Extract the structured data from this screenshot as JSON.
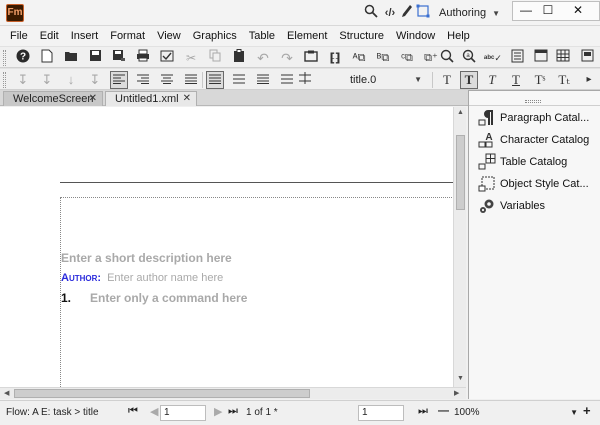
{
  "app": {
    "logo": "Fm",
    "workspace": "Authoring"
  },
  "title_icons": [
    "search-icon",
    "code-view-icon",
    "pen-icon",
    "frame-select-icon"
  ],
  "window_controls": {
    "minimize": "—",
    "maximize": "☐",
    "close": "✕"
  },
  "menu": [
    "File",
    "Edit",
    "Insert",
    "Format",
    "View",
    "Graphics",
    "Table",
    "Element",
    "Structure",
    "Window",
    "Help"
  ],
  "format_toolbar": {
    "style": "title.0"
  },
  "tabs": [
    {
      "label": "WelcomeScreen",
      "active": true
    },
    {
      "label": "Untitled1.xml",
      "active": false
    }
  ],
  "document": {
    "short_desc": "Enter a short description here",
    "author_label": "Author:",
    "author_placeholder": "Enter author name here",
    "command_number": "1.",
    "command_placeholder": "Enter only a command here"
  },
  "panel": {
    "items": [
      {
        "label": "Paragraph Catal...",
        "icon": "paragraph-catalog-icon"
      },
      {
        "label": "Character Catalog",
        "icon": "character-catalog-icon"
      },
      {
        "label": "Table Catalog",
        "icon": "table-catalog-icon"
      },
      {
        "label": "Object Style Cat...",
        "icon": "object-style-catalog-icon"
      },
      {
        "label": "Variables",
        "icon": "variables-icon"
      }
    ]
  },
  "status": {
    "flow": "Flow: A",
    "element": "E: task > title",
    "page_input": "1",
    "page_count": "1 of 1 *",
    "second_input": "1",
    "zoom": "100%"
  }
}
